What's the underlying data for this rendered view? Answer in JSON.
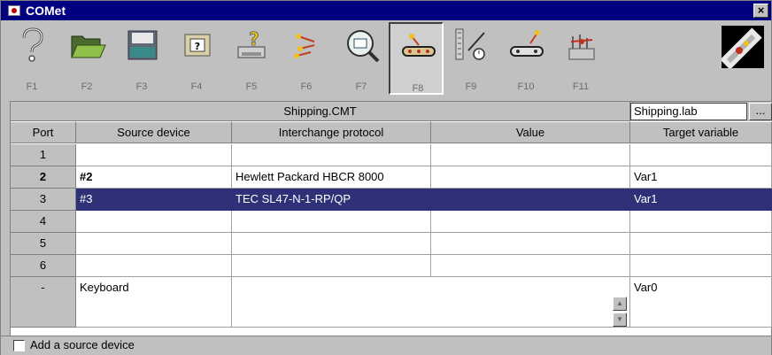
{
  "window": {
    "title": "COMet",
    "close_label": "×"
  },
  "toolbar": {
    "buttons": [
      {
        "key": "F1",
        "icon": "help-question-icon"
      },
      {
        "key": "F2",
        "icon": "open-folder-icon"
      },
      {
        "key": "F3",
        "icon": "save-disk-icon"
      },
      {
        "key": "F4",
        "icon": "device-info-icon"
      },
      {
        "key": "F5",
        "icon": "printer-help-icon"
      },
      {
        "key": "F6",
        "icon": "signal-connect-icon"
      },
      {
        "key": "F7",
        "icon": "magnifier-display-icon"
      },
      {
        "key": "F8",
        "icon": "conveyor-belt-icon"
      },
      {
        "key": "F9",
        "icon": "gauge-timer-icon"
      },
      {
        "key": "F10",
        "icon": "belt-scan-icon"
      },
      {
        "key": "F11",
        "icon": "network-router-icon"
      }
    ],
    "pressed_key": "F8",
    "logo_icon": "comet-logo-icon"
  },
  "file": {
    "cmt_name": "Shipping.CMT",
    "lab_name": "Shipping.lab",
    "browse_label": "..."
  },
  "table": {
    "headers": {
      "port": "Port",
      "source": "Source device",
      "protocol": "Interchange protocol",
      "value": "Value",
      "target": "Target variable"
    },
    "rows": [
      {
        "port": "1",
        "source": "",
        "protocol": "",
        "value": "",
        "target": ""
      },
      {
        "port": "2",
        "source": "#2",
        "protocol": "Hewlett Packard HBCR 8000",
        "value": "",
        "target": "Var1"
      },
      {
        "port": "3",
        "source": "#3",
        "protocol": "TEC SL47-N-1-RP/QP",
        "value": "",
        "target": "Var1"
      },
      {
        "port": "4",
        "source": "",
        "protocol": "",
        "value": "",
        "target": ""
      },
      {
        "port": "5",
        "source": "",
        "protocol": "",
        "value": "",
        "target": ""
      },
      {
        "port": "6",
        "source": "",
        "protocol": "",
        "value": "",
        "target": ""
      }
    ],
    "keyboard_row": {
      "port": "-",
      "source": "Keyboard",
      "protocol": "",
      "value": "",
      "target": "Var0"
    }
  },
  "footer": {
    "add_source_label": "Add a source device",
    "checked": false
  },
  "colors": {
    "titlebar": "#000080",
    "selection": "#2f3178",
    "face": "#c0c0c0"
  }
}
